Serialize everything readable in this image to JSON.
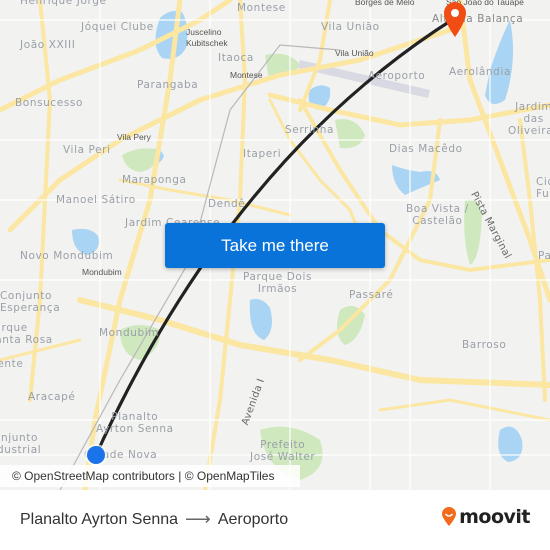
{
  "map": {
    "places": [
      {
        "id": "henrique-jorge",
        "label": "Henrique Jorge"
      },
      {
        "id": "joquei-clube",
        "label": "Jóquei Clube"
      },
      {
        "id": "joao-xxiii",
        "label": "João XXIII"
      },
      {
        "id": "montese-top",
        "label": "Montese"
      },
      {
        "id": "vila-uniao-top",
        "label": "Vila União"
      },
      {
        "id": "borges-de-melo",
        "label": "Borges de Melo"
      },
      {
        "id": "sao-joao-tauape",
        "label": "São João do Tauape"
      },
      {
        "id": "jk",
        "label": "Juscelino\nKubitschek"
      },
      {
        "id": "itaoca",
        "label": "Itaoca"
      },
      {
        "id": "montese-small",
        "label": "Montese"
      },
      {
        "id": "vila-uniao-small",
        "label": "Vila União"
      },
      {
        "id": "parangaba",
        "label": "Parangaba"
      },
      {
        "id": "bonsucesso",
        "label": "Bonsucesso"
      },
      {
        "id": "aeroporto",
        "label": "Aeroporto"
      },
      {
        "id": "aerolandia",
        "label": "Aerolândia"
      },
      {
        "id": "alto-balanca",
        "label": "Alto da Balança"
      },
      {
        "id": "jardim-oliveiras",
        "label": "Jardim das\nOliveiras"
      },
      {
        "id": "vila-pery",
        "label": "Vila Pery"
      },
      {
        "id": "vila-peri",
        "label": "Vila Peri"
      },
      {
        "id": "serrinha",
        "label": "Serrinha"
      },
      {
        "id": "itaperi",
        "label": "Itaperi"
      },
      {
        "id": "dias-macedo",
        "label": "Dias Macêdo"
      },
      {
        "id": "maraponga",
        "label": "Maraponga"
      },
      {
        "id": "manoel-satiro",
        "label": "Manoel Sátiro"
      },
      {
        "id": "dende",
        "label": "Dendê"
      },
      {
        "id": "jardim-cearense",
        "label": "Jardim Cearense"
      },
      {
        "id": "boa-vista",
        "label": "Boa Vista /\nCastelão"
      },
      {
        "id": "pista-marginal",
        "label": "Pista Marginal"
      },
      {
        "id": "cidade-func",
        "label": "Cidade dos\nFuncionários"
      },
      {
        "id": "novo-mondubim",
        "label": "Novo Mondubim"
      },
      {
        "id": "mondubim-small",
        "label": "Mondubim"
      },
      {
        "id": "parque-dois-irmaos",
        "label": "Parque Dois\nIrmãos"
      },
      {
        "id": "passare",
        "label": "Passaré"
      },
      {
        "id": "paupina",
        "label": "Paupina"
      },
      {
        "id": "conjunto-esperanca",
        "label": "Conjunto\nEsperança"
      },
      {
        "id": "parque-santa-rosa",
        "label": "Parque\nSanta Rosa"
      },
      {
        "id": "presidente",
        "label": "Presidente"
      },
      {
        "id": "mondubim",
        "label": "Mondubim"
      },
      {
        "id": "barroso",
        "label": "Barroso"
      },
      {
        "id": "aracape",
        "label": "Aracapé"
      },
      {
        "id": "avenida-i",
        "label": "Avenida I"
      },
      {
        "id": "planalto-ayrton-senna",
        "label": "Planalto\nAyrton Senna"
      },
      {
        "id": "conjunto-industrial",
        "label": "Conjunto\nIndustrial"
      },
      {
        "id": "cidade-nova",
        "label": "Cidade Nova"
      },
      {
        "id": "prefeito-jose-walter",
        "label": "Prefeito\nJosé Walter"
      }
    ],
    "cta_label": "Take me there",
    "attribution": "© OpenStreetMap contributors | © OpenMapTiles",
    "colors": {
      "route": "#222222",
      "origin": "#1a73e8",
      "destination": "#f24c15",
      "cta": "#0a73d9",
      "road": "#fbe6a2",
      "water": "#a9d4f3",
      "park": "#cfe8be"
    }
  },
  "footer": {
    "origin": "Planalto Ayrton Senna",
    "arrow": "⟶",
    "destination": "Aeroporto",
    "brand": "moovit",
    "brand_color": "#f26a1b"
  }
}
